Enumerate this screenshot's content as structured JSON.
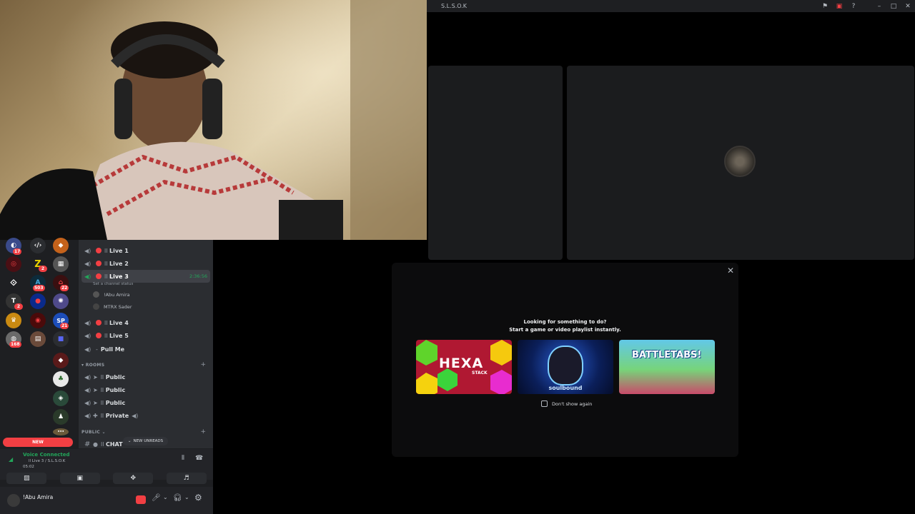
{
  "window": {
    "title": "S.L.S.O.K"
  },
  "channels": {
    "items": [
      {
        "label": "Live 1",
        "prefix": "ll"
      },
      {
        "label": "Live 2",
        "prefix": "ll"
      },
      {
        "label": "Live 3",
        "prefix": "ll",
        "timer": "2:36:56",
        "status": "Set a channel status"
      },
      {
        "label": "Live 4",
        "prefix": "ll"
      },
      {
        "label": "Live 5",
        "prefix": "ll"
      },
      {
        "label": "Pull Me",
        "prefix": "-"
      }
    ],
    "voice_users": [
      "!Abu Amira",
      "MTRX Sader"
    ],
    "rooms_category": "ROOMS",
    "rooms": [
      {
        "label": "Public",
        "prefix": "ll"
      },
      {
        "label": "Public",
        "prefix": "ll"
      },
      {
        "label": "Public",
        "prefix": "ll"
      },
      {
        "label": "Private",
        "prefix": "ll"
      }
    ],
    "public_category": "PUBLIC",
    "chat_channel": "CHAT",
    "chat_prefix": "ll"
  },
  "guild_badges": [
    "17",
    "2",
    "503",
    "22",
    "2",
    "21",
    "168"
  ],
  "new_pill": "NEW",
  "new_unreads": "NEW UNREADS",
  "voice": {
    "status": "Voice Connected",
    "channel": "ll Live 3 / S.L.S.O.K",
    "time": "05:02"
  },
  "user": {
    "name": "!Abu Amira"
  },
  "modal": {
    "line1": "Looking for something to do?",
    "line2": "Start a game or video playlist instantly.",
    "checkbox_label": "Don't show again",
    "cards": [
      {
        "name": "HEXA",
        "sub": "STACK"
      },
      {
        "name": "soulbound"
      },
      {
        "name": "BATTLETABS!"
      }
    ]
  },
  "colors": {
    "red": "#f23f43",
    "green": "#23a55a",
    "bg": "#1e1f22",
    "sidebar": "#2b2d31"
  }
}
